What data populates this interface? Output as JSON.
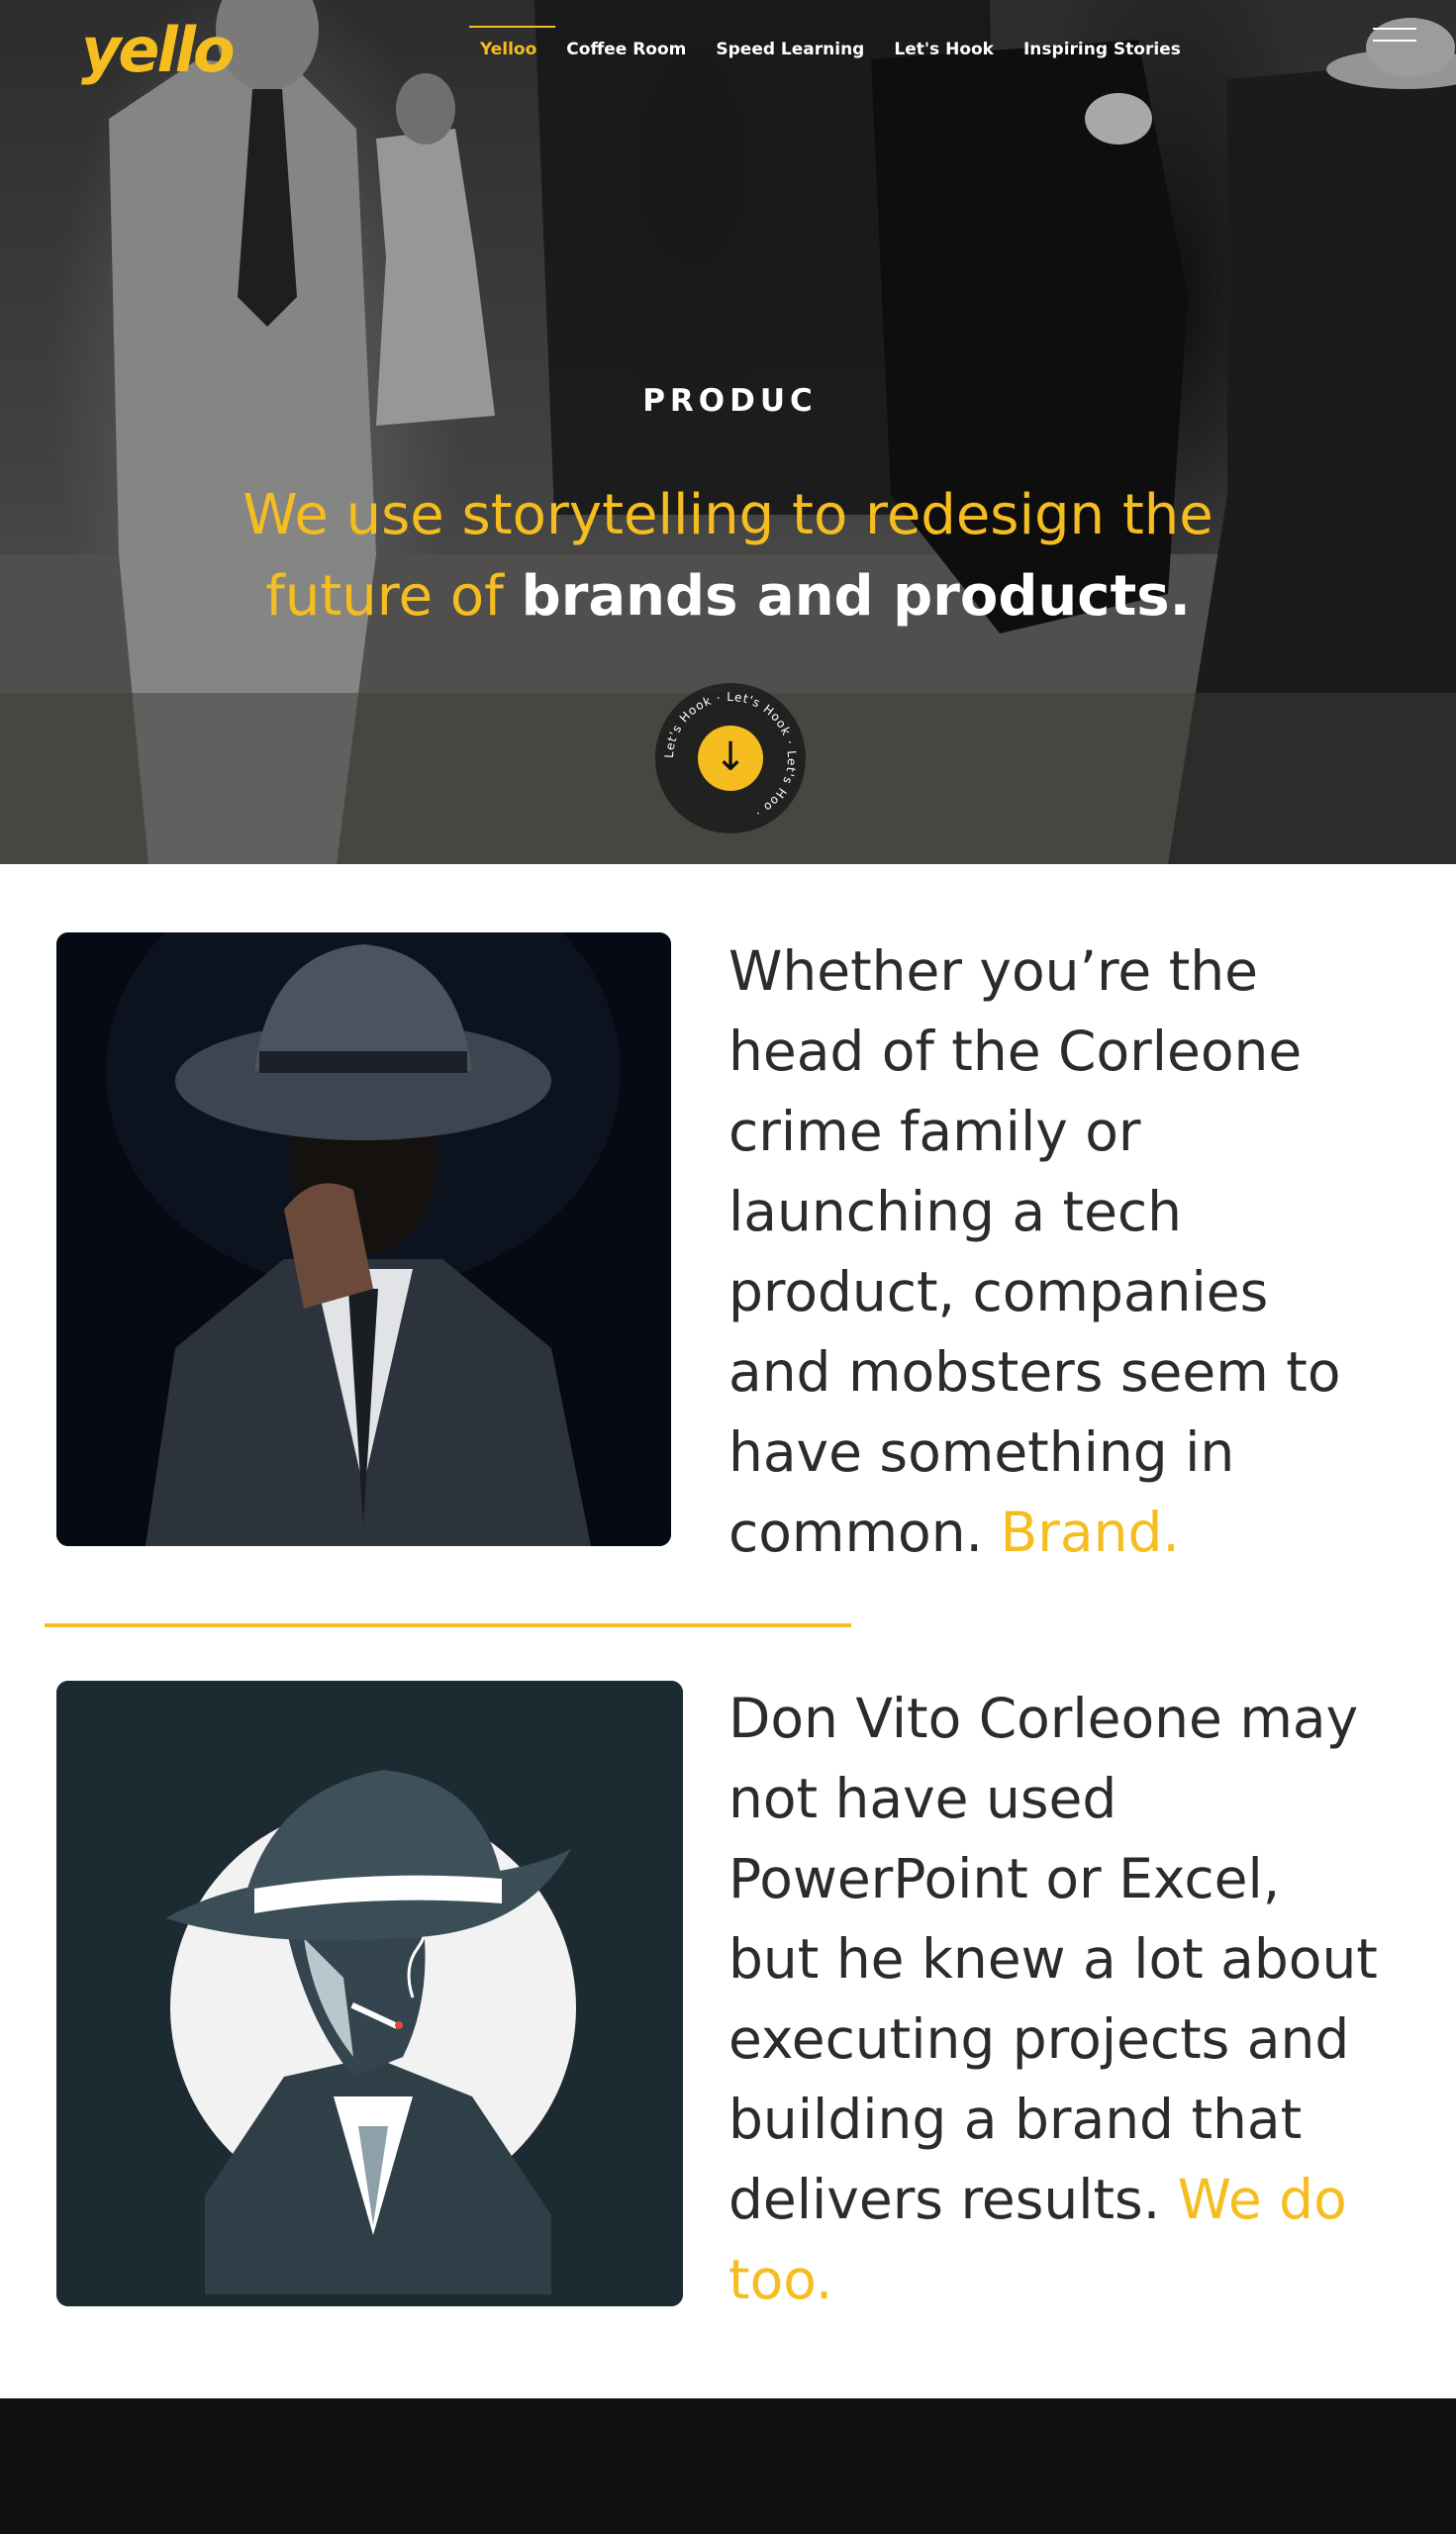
{
  "brand": {
    "logo_text": "yello",
    "accent_color": "#f5bd1f"
  },
  "nav": {
    "items": [
      {
        "label": "Yelloo",
        "active": true
      },
      {
        "label": "Coffee Room",
        "active": false
      },
      {
        "label": "Speed Learning",
        "active": false
      },
      {
        "label": "Let's Hook",
        "active": false
      },
      {
        "label": "Inspiring Stories",
        "active": false
      }
    ],
    "menu_icon": "hamburger-icon"
  },
  "hero": {
    "eyebrow": "PRODUC",
    "headline_line1": "We use storytelling to redesign the",
    "headline_line2_regular": "future of ",
    "headline_line2_strong": "brands and products.",
    "badge_text": "Let's Hook · Let's Hook · Let's Hoo ·",
    "scroll_icon": "arrow-down-icon",
    "scroll_glyph": "↓"
  },
  "sections": [
    {
      "image": "fedora-man-photo",
      "text": "Whether you’re the head of the Corleone crime family or launching a tech product, companies and mobsters seem to have something in common. ",
      "accent": "Brand."
    },
    {
      "image": "mobster-illustration",
      "text": "Don Vito Corleone may not have used PowerPoint or Excel, but he knew a lot about executing projects and building a brand that delivers results. ",
      "accent": "We do too."
    }
  ]
}
